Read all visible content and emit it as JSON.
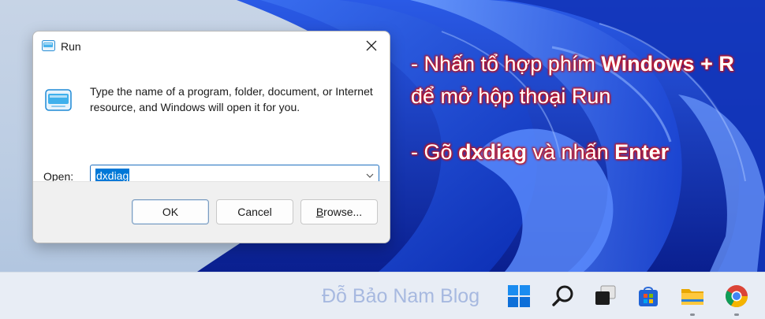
{
  "dialog": {
    "title": "Run",
    "description": "Type the name of a program, folder, document, or Internet resource, and Windows will open it for you.",
    "open_label_accel": "O",
    "open_label_rest": "pen:",
    "input_value": "dxdiag",
    "buttons": {
      "ok": "OK",
      "cancel": "Cancel",
      "browse_accel": "B",
      "browse_rest": "rowse..."
    }
  },
  "annotations": {
    "line1_prefix": "- Nhấn tổ hợp phím ",
    "line1_bold": "Windows + R",
    "line2": "để mở hộp thoại Run",
    "line3_prefix": "- Gõ ",
    "line3_bold1": "dxdiag",
    "line3_mid": " và nhấn ",
    "line3_bold2": "Enter"
  },
  "taskbar": {
    "watermark": "Đỗ Bảo Nam Blog",
    "icons": [
      "windows-start-icon",
      "search-icon",
      "task-view-icon",
      "microsoft-store-icon",
      "file-explorer-icon",
      "chrome-icon"
    ]
  },
  "colors": {
    "accent": "#0078d7",
    "annotation_outline": "#d0141e",
    "wallpaper_blue": "#1f4fd1"
  }
}
